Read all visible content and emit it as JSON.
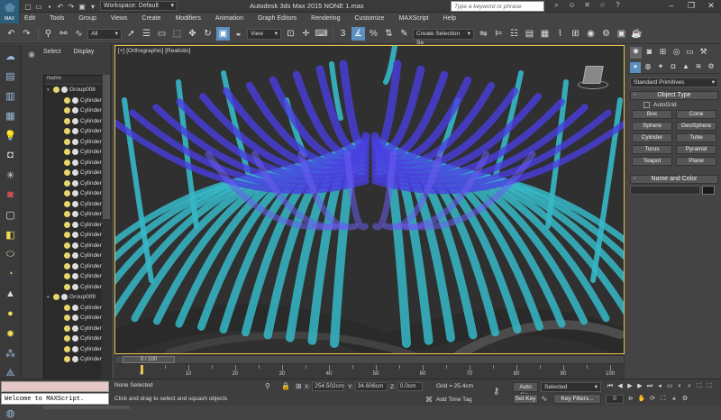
{
  "titlebar": {
    "logo_text": "MAX",
    "workspace_label": "Workspace: Default",
    "title": "Autodesk 3ds Max  2015     NONE 1.max",
    "search_placeholder": "Type a keyword or phrase"
  },
  "menu": [
    "Edit",
    "Tools",
    "Group",
    "Views",
    "Create",
    "Modifiers",
    "Animation",
    "Graph Editors",
    "Rendering",
    "Customize",
    "MAXScript",
    "Help"
  ],
  "toolbar": {
    "filter_value": "All",
    "refcoord_value": "View",
    "named_selection_placeholder": "Create Selection Se"
  },
  "explorer": {
    "tabs": [
      "Select",
      "Display"
    ],
    "column_header": "Name",
    "rows": [
      {
        "type": "group",
        "label": "Group008"
      },
      {
        "type": "child",
        "label": "Cylinder"
      },
      {
        "type": "child",
        "label": "Cylinder"
      },
      {
        "type": "child",
        "label": "Cylinder"
      },
      {
        "type": "child",
        "label": "Cylinder"
      },
      {
        "type": "child",
        "label": "Cylinder"
      },
      {
        "type": "child",
        "label": "Cylinder"
      },
      {
        "type": "child",
        "label": "Cylinder"
      },
      {
        "type": "child",
        "label": "Cylinder"
      },
      {
        "type": "child",
        "label": "Cylinder"
      },
      {
        "type": "child",
        "label": "Cylinder"
      },
      {
        "type": "child",
        "label": "Cylinder"
      },
      {
        "type": "child",
        "label": "Cylinder"
      },
      {
        "type": "child",
        "label": "Cylinder"
      },
      {
        "type": "child",
        "label": "Cylinder"
      },
      {
        "type": "child",
        "label": "Cylinder"
      },
      {
        "type": "child",
        "label": "Cylinder"
      },
      {
        "type": "child",
        "label": "Cylinder"
      },
      {
        "type": "child",
        "label": "Cylinder"
      },
      {
        "type": "child",
        "label": "Cylinder"
      },
      {
        "type": "group",
        "label": "Group009"
      },
      {
        "type": "child",
        "label": "Cylinder"
      },
      {
        "type": "child",
        "label": "Cylinder"
      },
      {
        "type": "child",
        "label": "Cylinder"
      },
      {
        "type": "child",
        "label": "Cylinder"
      },
      {
        "type": "child",
        "label": "Cylinder"
      },
      {
        "type": "child",
        "label": "Cylinder"
      }
    ]
  },
  "viewport": {
    "label": "[+] [Orthographic] [Realistic]"
  },
  "command_panel": {
    "category": "Standard Primitives",
    "object_type_title": "Object Type",
    "autogrid_label": "AutoGrid",
    "primitives": [
      "Box",
      "Cone",
      "Sphere",
      "GeoSphere",
      "Cylinder",
      "Tube",
      "Torus",
      "Pyramid",
      "Teapot",
      "Plane"
    ],
    "name_color_title": "Name and Color"
  },
  "timeline": {
    "slider_label": "0 / 100",
    "ticks": [
      0,
      10,
      20,
      30,
      40,
      50,
      60,
      70,
      80,
      90,
      100
    ]
  },
  "status": {
    "maxscript_output": "Welcome to MAXScript.",
    "selection": "None Selected",
    "prompt": "Click and drag to select and squash objects",
    "x_label": "X:",
    "x_value": "254.502cm",
    "y_label": "Y:",
    "y_value": "34.606cm",
    "z_label": "Z:",
    "z_value": "0.0cm",
    "grid": "Grid = 25.4cm",
    "add_time_tag": "Add Time Tag",
    "auto_key": "Auto Key",
    "set_key": "Set Key",
    "key_mode": "Selected",
    "key_filters": "Key Filters...",
    "frame": "0"
  },
  "colors": {
    "viewport_border": "#e6c24a",
    "upper_fronds": "#4a3ee0",
    "lower_fronds": "#36b8c8",
    "highlight": "#5a8fc0"
  }
}
